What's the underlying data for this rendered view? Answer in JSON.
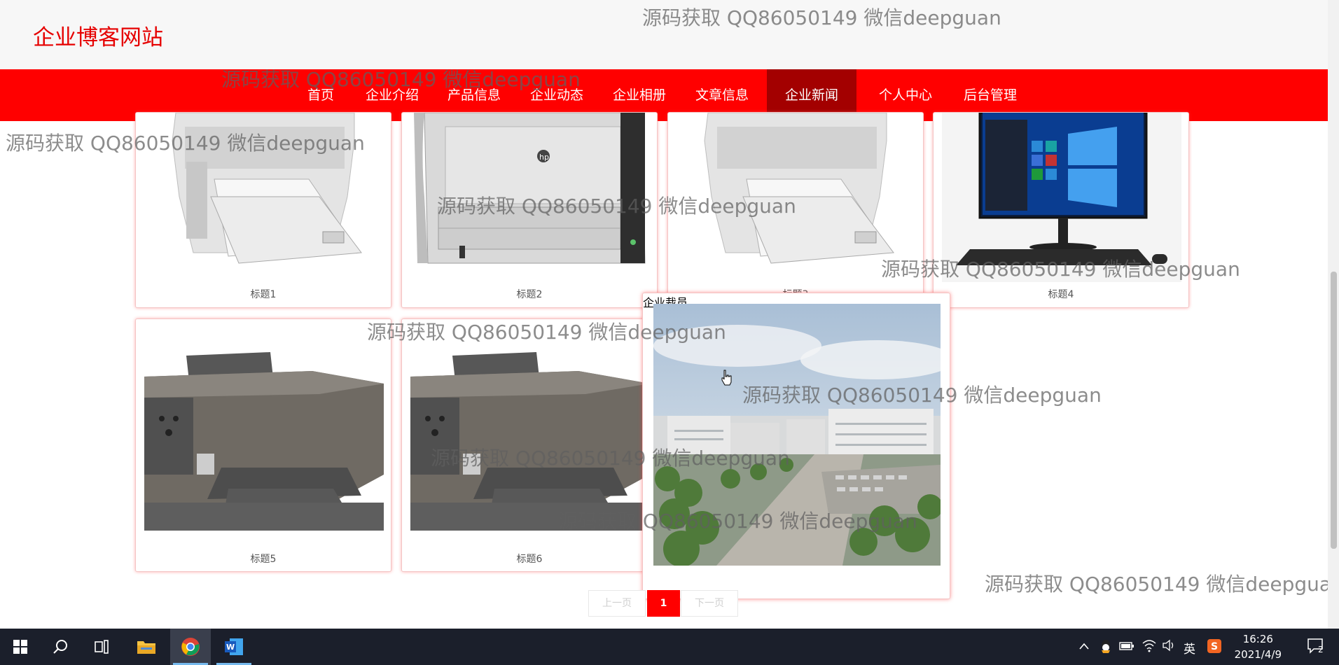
{
  "site": {
    "title": "企业博客网站"
  },
  "nav": {
    "items": [
      {
        "label": "首页"
      },
      {
        "label": "企业介绍"
      },
      {
        "label": "产品信息"
      },
      {
        "label": "企业动态"
      },
      {
        "label": "企业相册"
      },
      {
        "label": "文章信息"
      },
      {
        "label": "企业新闻",
        "active": true
      },
      {
        "label": "个人中心"
      },
      {
        "label": "后台管理"
      }
    ]
  },
  "cards": [
    {
      "caption": "标题1",
      "image": "laser-printer"
    },
    {
      "caption": "标题2",
      "image": "hp-laser-printer"
    },
    {
      "caption": "标题3",
      "image": "laser-printer"
    },
    {
      "caption": "标题4",
      "image": "desktop-pc-windows10"
    },
    {
      "caption": "标题5",
      "image": "inkjet-printer"
    },
    {
      "caption": "标题6",
      "image": "inkjet-printer"
    }
  ],
  "popup_card": {
    "caption": "企业裁员",
    "image": "factory-building-aerial"
  },
  "pagination": {
    "prev": "上一页",
    "current": "1",
    "next": "下一页"
  },
  "watermark": "源码获取 QQ86050149 微信deepguan",
  "taskbar": {
    "apps": [
      "windows-start-icon",
      "search-icon",
      "task-view-icon",
      "file-explorer-icon",
      "chrome-icon",
      "word-icon"
    ],
    "ime": "英",
    "time": "16:26",
    "date": "2021/4/9",
    "notifications": "2"
  },
  "colors": {
    "brand": "#ff0000",
    "nav_active": "#a30000",
    "title": "#e60000"
  }
}
